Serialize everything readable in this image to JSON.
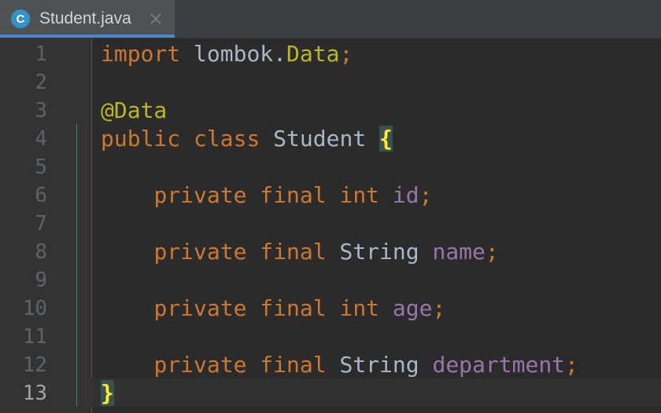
{
  "tab": {
    "title": "Student.java",
    "icon": "java-class-icon",
    "icon_letter": "C",
    "close": "×"
  },
  "editor": {
    "current_line": 13,
    "line_numbers": [
      "1",
      "2",
      "3",
      "4",
      "5",
      "6",
      "7",
      "8",
      "9",
      "10",
      "11",
      "12",
      "13"
    ],
    "code": {
      "l1": {
        "kw": "import",
        "pkg": " lombok.",
        "cls": "Data",
        "semi": ";"
      },
      "l3": {
        "annotation": "@Data"
      },
      "l4": {
        "kw1": "public",
        "kw2": " class",
        "name": " Student ",
        "brace": "{"
      },
      "l6": {
        "indent": "    ",
        "kw1": "private",
        "kw2": " final",
        "type": " int ",
        "field": "id",
        "semi": ";"
      },
      "l8": {
        "indent": "    ",
        "kw1": "private",
        "kw2": " final",
        "type": " String ",
        "field": "name",
        "semi": ";"
      },
      "l10": {
        "indent": "    ",
        "kw1": "private",
        "kw2": " final",
        "type": " int ",
        "field": "age",
        "semi": ";"
      },
      "l12": {
        "indent": "    ",
        "kw1": "private",
        "kw2": " final",
        "type": " String ",
        "field": "department",
        "semi": ";"
      },
      "l13": {
        "brace": "}"
      }
    }
  },
  "colors": {
    "keyword": "#cc7832",
    "annotation": "#bbb529",
    "field": "#9876aa",
    "text": "#a9b7c6",
    "background": "#2b2b2b",
    "tab_accent": "#4a88c7"
  }
}
